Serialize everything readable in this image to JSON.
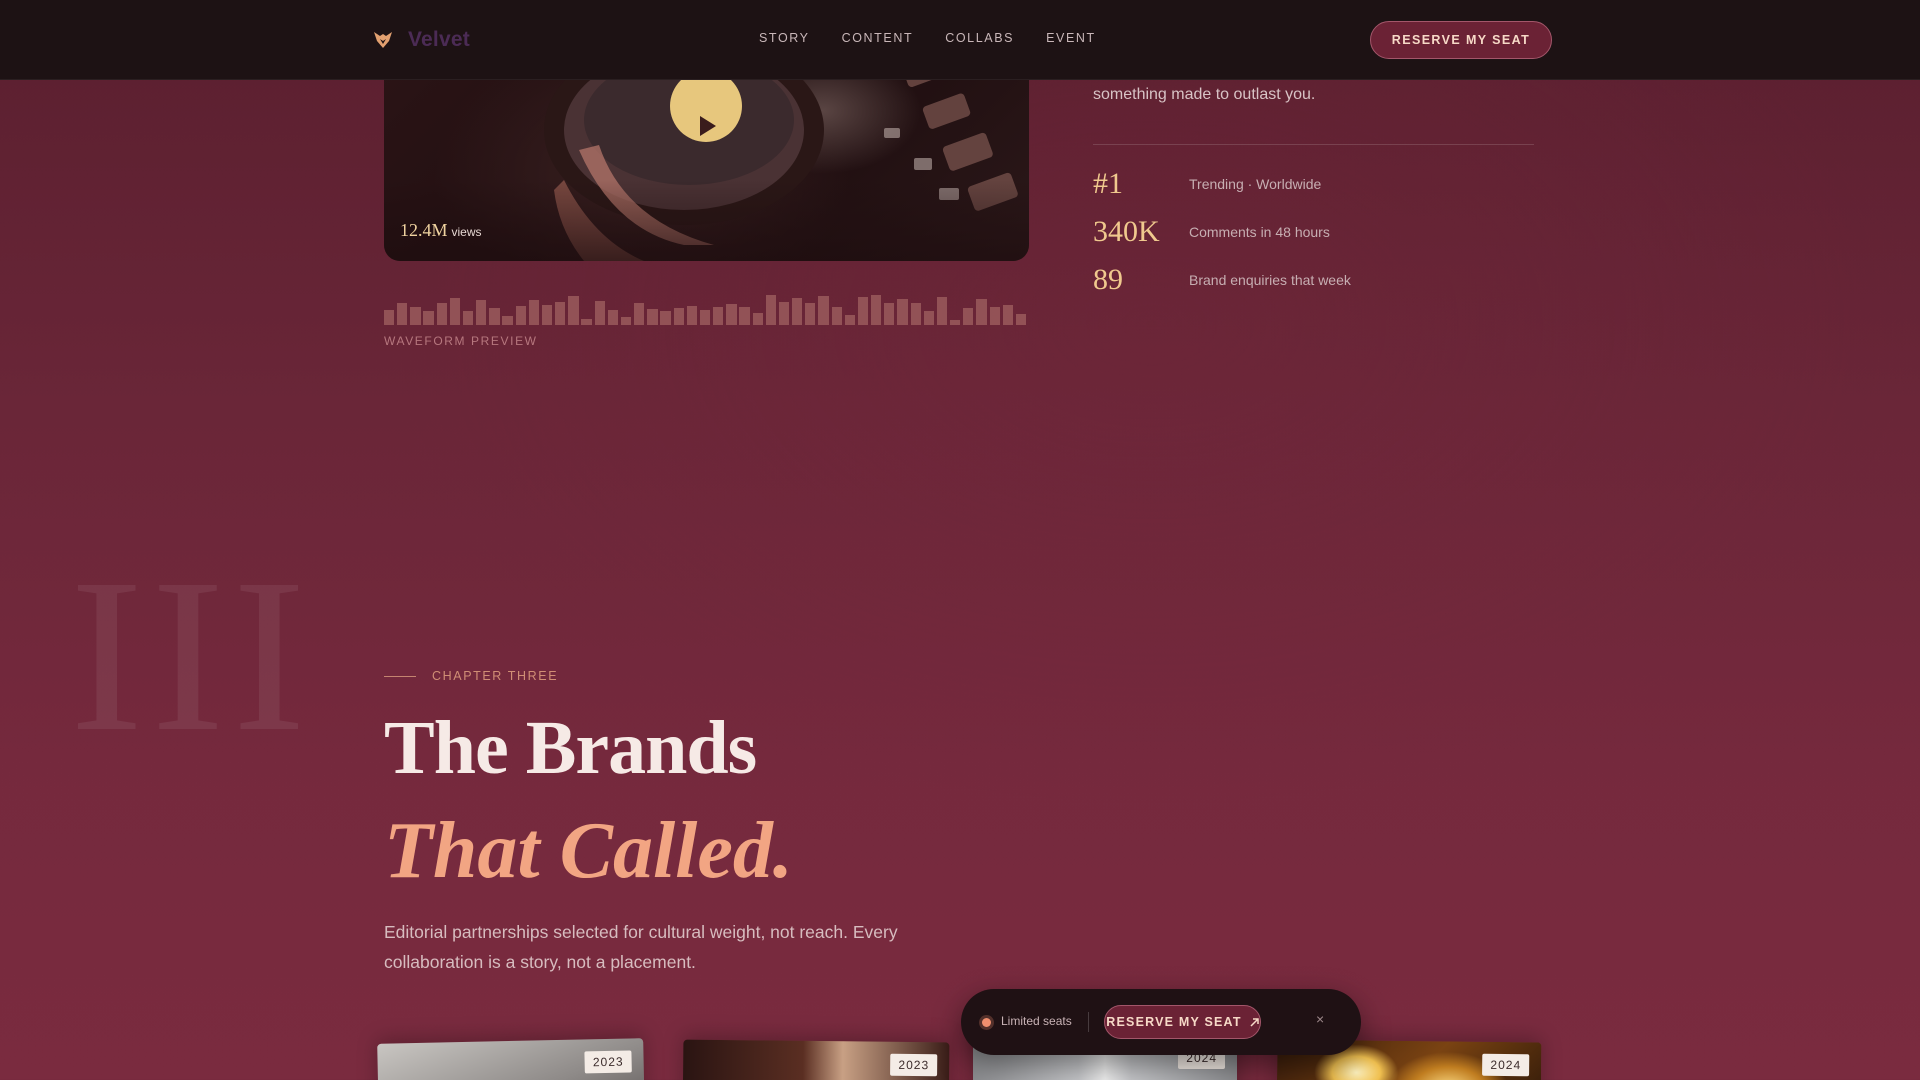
{
  "nav": {
    "brand_name": "Velvet",
    "logo_icon": "fox-logo-icon",
    "links": [
      "STORY",
      "CONTENT",
      "COLLABS",
      "EVENT"
    ],
    "cta_label": "RESERVE MY SEAT"
  },
  "video": {
    "views_value": "12.4M",
    "views_label": "views",
    "play_icon": "play-icon"
  },
  "waveform": {
    "caption": "WAVEFORM PREVIEW",
    "levels": [
      0.38,
      0.55,
      0.45,
      0.35,
      0.55,
      0.68,
      0.35,
      0.62,
      0.42,
      0.22,
      0.48,
      0.62,
      0.5,
      0.58,
      0.72,
      0.15,
      0.6,
      0.38,
      0.2,
      0.55,
      0.4,
      0.35,
      0.42,
      0.48,
      0.38,
      0.45,
      0.52,
      0.45,
      0.3,
      0.75,
      0.58,
      0.68,
      0.55,
      0.72,
      0.45,
      0.25,
      0.7,
      0.75,
      0.55,
      0.65,
      0.55,
      0.35,
      0.7,
      0.12,
      0.42,
      0.65,
      0.45,
      0.5,
      0.28
    ]
  },
  "story": {
    "tagline": "something made to outlast you.",
    "stats": [
      {
        "value": "#1",
        "label": "Trending · Worldwide"
      },
      {
        "value": "340K",
        "label": "Comments in 48 hours"
      },
      {
        "value": "89",
        "label": "Brand enquiries that week"
      }
    ]
  },
  "chapter": {
    "roman": "III",
    "label": "CHAPTER THREE",
    "title_line1": "The Brands",
    "title_line2": "That Called.",
    "lead": "Editorial partnerships selected for cultural weight, not reach. Every collaboration is a story, not a placement."
  },
  "cards": [
    {
      "year": "2023"
    },
    {
      "year": "2023"
    },
    {
      "year": "2024"
    },
    {
      "year": "2024"
    }
  ],
  "floating_bar": {
    "status_label": "Limited seats",
    "cta_label": "RESERVE MY SEAT",
    "cta_icon": "arrow-up-right-icon",
    "close_icon": "close-icon",
    "close_glyph": "×"
  },
  "colors": {
    "accent": "#f2a583",
    "gold": "#f0c98e",
    "nav_bg": "#1d1214",
    "page_bg": "#6a2638",
    "button_bg": "#6b2235"
  }
}
